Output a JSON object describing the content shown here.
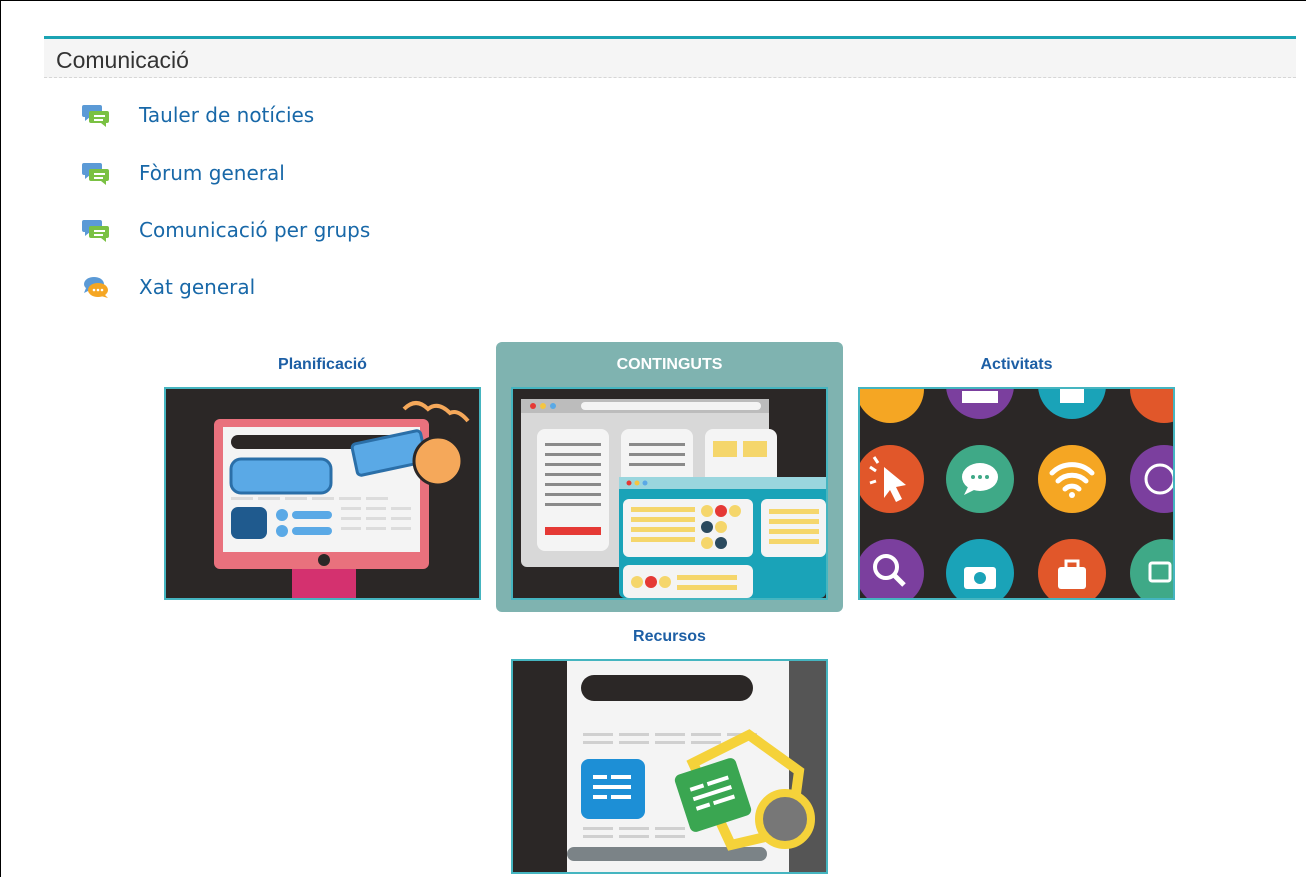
{
  "section": {
    "title": "Comunicació"
  },
  "activities": [
    {
      "label": "Tauler de notícies",
      "icon": "forum-icon"
    },
    {
      "label": "Fòrum general",
      "icon": "forum-icon"
    },
    {
      "label": "Comunicació per grups",
      "icon": "forum-icon"
    },
    {
      "label": "Xat general",
      "icon": "chat-icon"
    }
  ],
  "tiles": [
    {
      "label": "Planificació",
      "active": false
    },
    {
      "label": "CONTINGUTS",
      "active": true
    },
    {
      "label": "Activitats",
      "active": false
    },
    {
      "label": "Recursos",
      "active": false
    }
  ],
  "colors": {
    "accent": "#1ba3b3",
    "link": "#1868a8",
    "tile_label": "#1d5fa5",
    "active_tile_bg": "#7fb3b0"
  }
}
